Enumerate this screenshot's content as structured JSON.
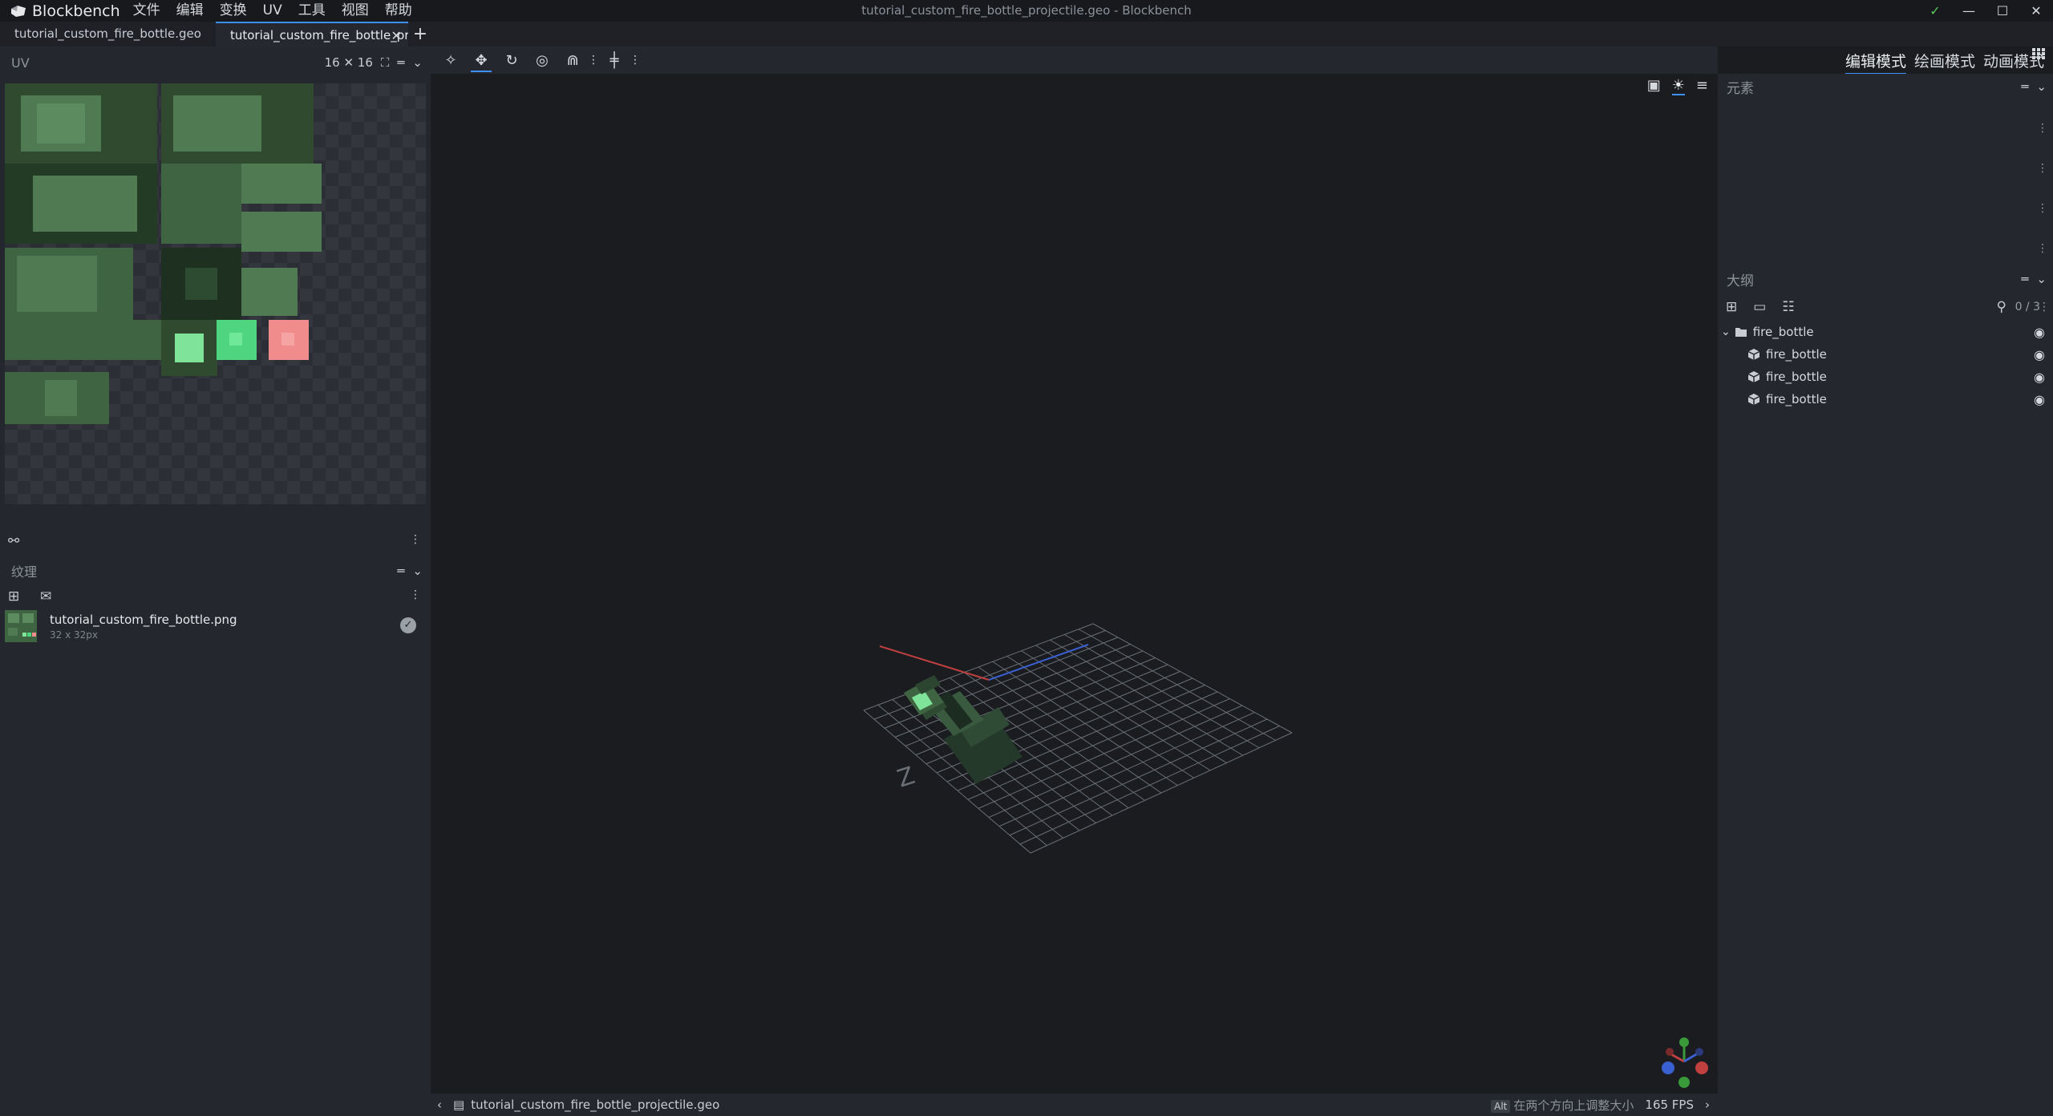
{
  "app": {
    "name": "Blockbench",
    "window_title": "tutorial_custom_fire_bottle_projectile.geo - Blockbench",
    "menu": [
      "文件",
      "编辑",
      "变换",
      "UV",
      "工具",
      "视图",
      "帮助"
    ]
  },
  "tabs": [
    {
      "label": "tutorial_custom_fire_bottle.geo",
      "active": false
    },
    {
      "label": "tutorial_custom_fire_bottle_projectile.geo",
      "active": true
    }
  ],
  "uv_panel": {
    "title": "UV",
    "size": "16 ✕ 16"
  },
  "texture_panel": {
    "title": "纹理",
    "items": [
      {
        "name": "tutorial_custom_fire_bottle.png",
        "size": "32 x 32px"
      }
    ]
  },
  "modes": [
    {
      "label": "编辑模式",
      "active": true
    },
    {
      "label": "绘画模式",
      "active": false
    },
    {
      "label": "动画模式",
      "active": false
    }
  ],
  "elements_panel": {
    "title": "元素"
  },
  "outliner": {
    "title": "大纲",
    "count": "0 / 3",
    "group": "fire_bottle",
    "children": [
      "fire_bottle",
      "fire_bottle",
      "fire_bottle"
    ]
  },
  "status": {
    "file": "tutorial_custom_fire_bottle_projectile.geo",
    "key": "Alt",
    "hint": "在两个方向上调整大小",
    "fps": "165 FPS"
  },
  "colors": {
    "accent": "#3e90ff",
    "panel": "#24272d",
    "viewport": "#1a1c20"
  }
}
